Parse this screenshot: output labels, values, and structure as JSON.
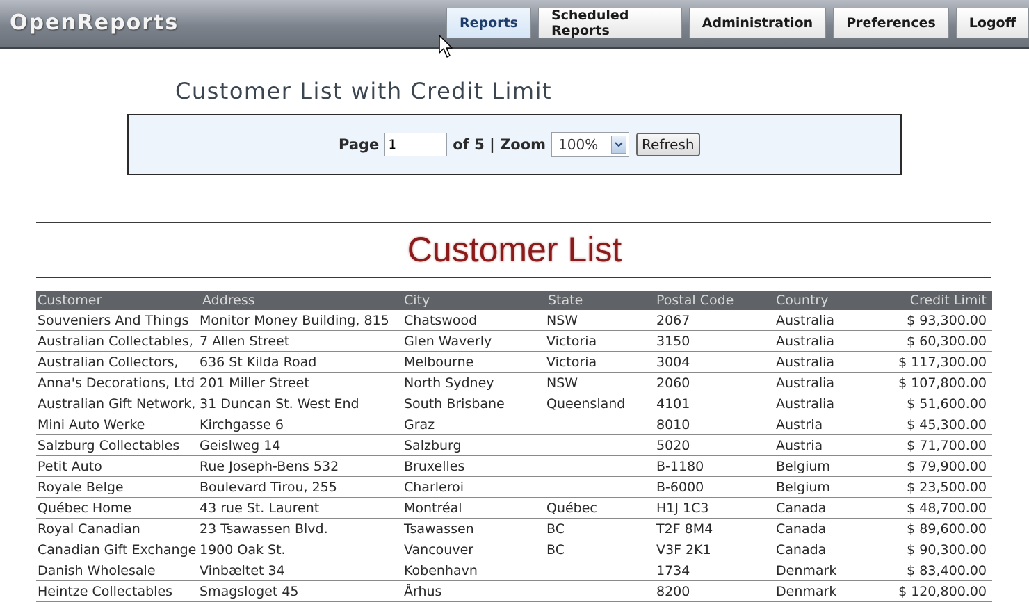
{
  "app": {
    "brand": "OpenReports"
  },
  "nav": {
    "items": [
      {
        "label": "Reports",
        "active": true
      },
      {
        "label": "Scheduled Reports",
        "active": false
      },
      {
        "label": "Administration",
        "active": false
      },
      {
        "label": "Preferences",
        "active": false
      },
      {
        "label": "Logoff",
        "active": false
      }
    ]
  },
  "report": {
    "title": "Customer List with Credit Limit"
  },
  "pager": {
    "page_label": "Page",
    "page_value": "1",
    "of_label": "of 5 | Zoom",
    "zoom_value": "100%",
    "refresh_label": "Refresh"
  },
  "list": {
    "title": "Customer List",
    "columns": [
      "Customer",
      "Address",
      "City",
      "State",
      "Postal Code",
      "Country",
      "Credit Limit"
    ],
    "rows": [
      [
        "Souveniers And Things",
        "Monitor Money Building, 815",
        "Chatswood",
        "NSW",
        "2067",
        "Australia",
        "$ 93,300.00"
      ],
      [
        "Australian Collectables,",
        "7 Allen Street",
        "Glen Waverly",
        "Victoria",
        "3150",
        "Australia",
        "$ 60,300.00"
      ],
      [
        "Australian Collectors,",
        "636 St Kilda Road",
        "Melbourne",
        "Victoria",
        "3004",
        "Australia",
        "$ 117,300.00"
      ],
      [
        "Anna's Decorations, Ltd",
        "201 Miller Street",
        "North Sydney",
        "NSW",
        "2060",
        "Australia",
        "$ 107,800.00"
      ],
      [
        "Australian Gift Network,",
        "31 Duncan St. West End",
        "South Brisbane",
        "Queensland",
        "4101",
        "Australia",
        "$ 51,600.00"
      ],
      [
        "Mini Auto Werke",
        "Kirchgasse 6",
        "Graz",
        "",
        "8010",
        "Austria",
        "$ 45,300.00"
      ],
      [
        "Salzburg Collectables",
        "Geislweg 14",
        "Salzburg",
        "",
        "5020",
        "Austria",
        "$ 71,700.00"
      ],
      [
        "Petit Auto",
        "Rue Joseph-Bens 532",
        "Bruxelles",
        "",
        "B-1180",
        "Belgium",
        "$ 79,900.00"
      ],
      [
        "Royale Belge",
        "Boulevard Tirou, 255",
        "Charleroi",
        "",
        "B-6000",
        "Belgium",
        "$ 23,500.00"
      ],
      [
        "Québec Home",
        "43 rue St. Laurent",
        "Montréal",
        "Québec",
        "H1J 1C3",
        "Canada",
        "$ 48,700.00"
      ],
      [
        "Royal Canadian",
        "23 Tsawassen Blvd.",
        "Tsawassen",
        "BC",
        "T2F 8M4",
        "Canada",
        "$ 89,600.00"
      ],
      [
        "Canadian Gift Exchange",
        "1900 Oak St.",
        "Vancouver",
        "BC",
        "V3F 2K1",
        "Canada",
        "$ 90,300.00"
      ],
      [
        "Danish Wholesale",
        "Vinbæltet 34",
        "Kobenhavn",
        "",
        "1734",
        "Denmark",
        "$ 83,400.00"
      ],
      [
        "Heintze Collectables",
        "Smagsloget 45",
        "Århus",
        "",
        "8200",
        "Denmark",
        "$ 120,800.00"
      ]
    ]
  }
}
